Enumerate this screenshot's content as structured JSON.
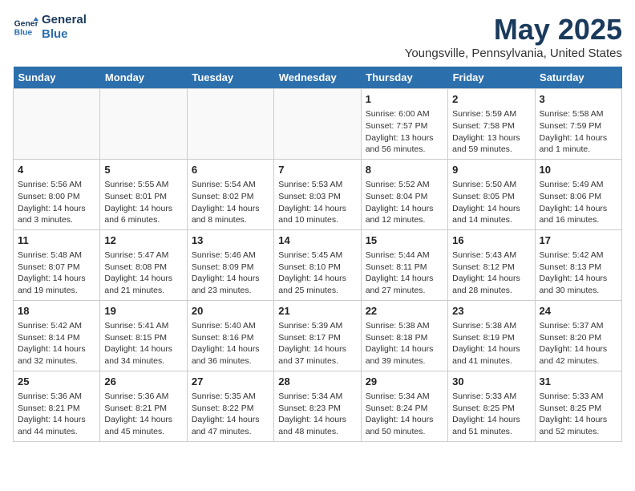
{
  "header": {
    "logo_line1": "General",
    "logo_line2": "Blue",
    "month": "May 2025",
    "location": "Youngsville, Pennsylvania, United States"
  },
  "days_of_week": [
    "Sunday",
    "Monday",
    "Tuesday",
    "Wednesday",
    "Thursday",
    "Friday",
    "Saturday"
  ],
  "weeks": [
    [
      {
        "day": "",
        "content": ""
      },
      {
        "day": "",
        "content": ""
      },
      {
        "day": "",
        "content": ""
      },
      {
        "day": "",
        "content": ""
      },
      {
        "day": "1",
        "content": "Sunrise: 6:00 AM\nSunset: 7:57 PM\nDaylight: 13 hours\nand 56 minutes."
      },
      {
        "day": "2",
        "content": "Sunrise: 5:59 AM\nSunset: 7:58 PM\nDaylight: 13 hours\nand 59 minutes."
      },
      {
        "day": "3",
        "content": "Sunrise: 5:58 AM\nSunset: 7:59 PM\nDaylight: 14 hours\nand 1 minute."
      }
    ],
    [
      {
        "day": "4",
        "content": "Sunrise: 5:56 AM\nSunset: 8:00 PM\nDaylight: 14 hours\nand 3 minutes."
      },
      {
        "day": "5",
        "content": "Sunrise: 5:55 AM\nSunset: 8:01 PM\nDaylight: 14 hours\nand 6 minutes."
      },
      {
        "day": "6",
        "content": "Sunrise: 5:54 AM\nSunset: 8:02 PM\nDaylight: 14 hours\nand 8 minutes."
      },
      {
        "day": "7",
        "content": "Sunrise: 5:53 AM\nSunset: 8:03 PM\nDaylight: 14 hours\nand 10 minutes."
      },
      {
        "day": "8",
        "content": "Sunrise: 5:52 AM\nSunset: 8:04 PM\nDaylight: 14 hours\nand 12 minutes."
      },
      {
        "day": "9",
        "content": "Sunrise: 5:50 AM\nSunset: 8:05 PM\nDaylight: 14 hours\nand 14 minutes."
      },
      {
        "day": "10",
        "content": "Sunrise: 5:49 AM\nSunset: 8:06 PM\nDaylight: 14 hours\nand 16 minutes."
      }
    ],
    [
      {
        "day": "11",
        "content": "Sunrise: 5:48 AM\nSunset: 8:07 PM\nDaylight: 14 hours\nand 19 minutes."
      },
      {
        "day": "12",
        "content": "Sunrise: 5:47 AM\nSunset: 8:08 PM\nDaylight: 14 hours\nand 21 minutes."
      },
      {
        "day": "13",
        "content": "Sunrise: 5:46 AM\nSunset: 8:09 PM\nDaylight: 14 hours\nand 23 minutes."
      },
      {
        "day": "14",
        "content": "Sunrise: 5:45 AM\nSunset: 8:10 PM\nDaylight: 14 hours\nand 25 minutes."
      },
      {
        "day": "15",
        "content": "Sunrise: 5:44 AM\nSunset: 8:11 PM\nDaylight: 14 hours\nand 27 minutes."
      },
      {
        "day": "16",
        "content": "Sunrise: 5:43 AM\nSunset: 8:12 PM\nDaylight: 14 hours\nand 28 minutes."
      },
      {
        "day": "17",
        "content": "Sunrise: 5:42 AM\nSunset: 8:13 PM\nDaylight: 14 hours\nand 30 minutes."
      }
    ],
    [
      {
        "day": "18",
        "content": "Sunrise: 5:42 AM\nSunset: 8:14 PM\nDaylight: 14 hours\nand 32 minutes."
      },
      {
        "day": "19",
        "content": "Sunrise: 5:41 AM\nSunset: 8:15 PM\nDaylight: 14 hours\nand 34 minutes."
      },
      {
        "day": "20",
        "content": "Sunrise: 5:40 AM\nSunset: 8:16 PM\nDaylight: 14 hours\nand 36 minutes."
      },
      {
        "day": "21",
        "content": "Sunrise: 5:39 AM\nSunset: 8:17 PM\nDaylight: 14 hours\nand 37 minutes."
      },
      {
        "day": "22",
        "content": "Sunrise: 5:38 AM\nSunset: 8:18 PM\nDaylight: 14 hours\nand 39 minutes."
      },
      {
        "day": "23",
        "content": "Sunrise: 5:38 AM\nSunset: 8:19 PM\nDaylight: 14 hours\nand 41 minutes."
      },
      {
        "day": "24",
        "content": "Sunrise: 5:37 AM\nSunset: 8:20 PM\nDaylight: 14 hours\nand 42 minutes."
      }
    ],
    [
      {
        "day": "25",
        "content": "Sunrise: 5:36 AM\nSunset: 8:21 PM\nDaylight: 14 hours\nand 44 minutes."
      },
      {
        "day": "26",
        "content": "Sunrise: 5:36 AM\nSunset: 8:21 PM\nDaylight: 14 hours\nand 45 minutes."
      },
      {
        "day": "27",
        "content": "Sunrise: 5:35 AM\nSunset: 8:22 PM\nDaylight: 14 hours\nand 47 minutes."
      },
      {
        "day": "28",
        "content": "Sunrise: 5:34 AM\nSunset: 8:23 PM\nDaylight: 14 hours\nand 48 minutes."
      },
      {
        "day": "29",
        "content": "Sunrise: 5:34 AM\nSunset: 8:24 PM\nDaylight: 14 hours\nand 50 minutes."
      },
      {
        "day": "30",
        "content": "Sunrise: 5:33 AM\nSunset: 8:25 PM\nDaylight: 14 hours\nand 51 minutes."
      },
      {
        "day": "31",
        "content": "Sunrise: 5:33 AM\nSunset: 8:25 PM\nDaylight: 14 hours\nand 52 minutes."
      }
    ]
  ]
}
